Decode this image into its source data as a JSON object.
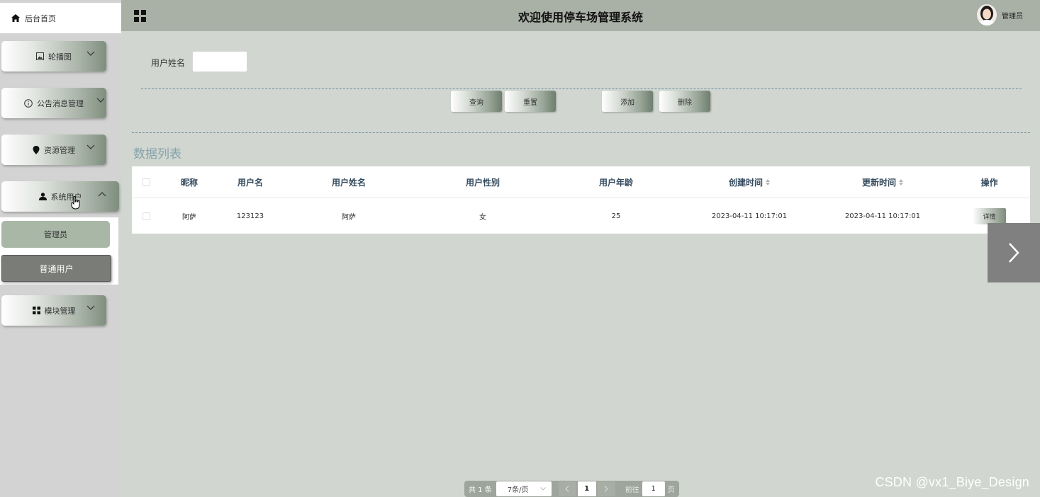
{
  "sidebar": {
    "home_label": "后台首页",
    "menus": [
      {
        "label": "轮播图",
        "icon": "picture-icon"
      },
      {
        "label": "公告消息管理",
        "icon": "info-circle-icon"
      },
      {
        "label": "资源管理",
        "icon": "location-pin-icon"
      },
      {
        "label": "系统用户",
        "icon": "person-icon"
      },
      {
        "label": "模块管理",
        "icon": "grid-icon"
      }
    ],
    "submenu": {
      "admin": "管理员",
      "user": "普通用户"
    }
  },
  "header": {
    "title": "欢迎使用停车场管理系统",
    "user_label": "管理员"
  },
  "search": {
    "label": "用户姓名",
    "value": ""
  },
  "actions": {
    "query": "查询",
    "reset": "重置",
    "add": "添加",
    "delete": "删除"
  },
  "list_title": "数据列表",
  "table": {
    "columns": [
      "昵称",
      "用户名",
      "用户姓名",
      "用户性别",
      "用户年龄",
      "创建时间",
      "更新时间",
      "操作"
    ],
    "rows": [
      {
        "nickname": "阿萨",
        "username": "123123",
        "realname": "阿萨",
        "gender": "女",
        "age": "25",
        "created": "2023-04-11 10:17:01",
        "updated": "2023-04-11 10:17:01",
        "action": "详情"
      }
    ]
  },
  "pagination": {
    "total": "共 1 条",
    "page_size": "7条/页",
    "current_page": "1",
    "goto_label": "前往",
    "goto_value": "1",
    "page_suffix": "页"
  },
  "watermark": "CSDN @vx1_Biye_Design"
}
